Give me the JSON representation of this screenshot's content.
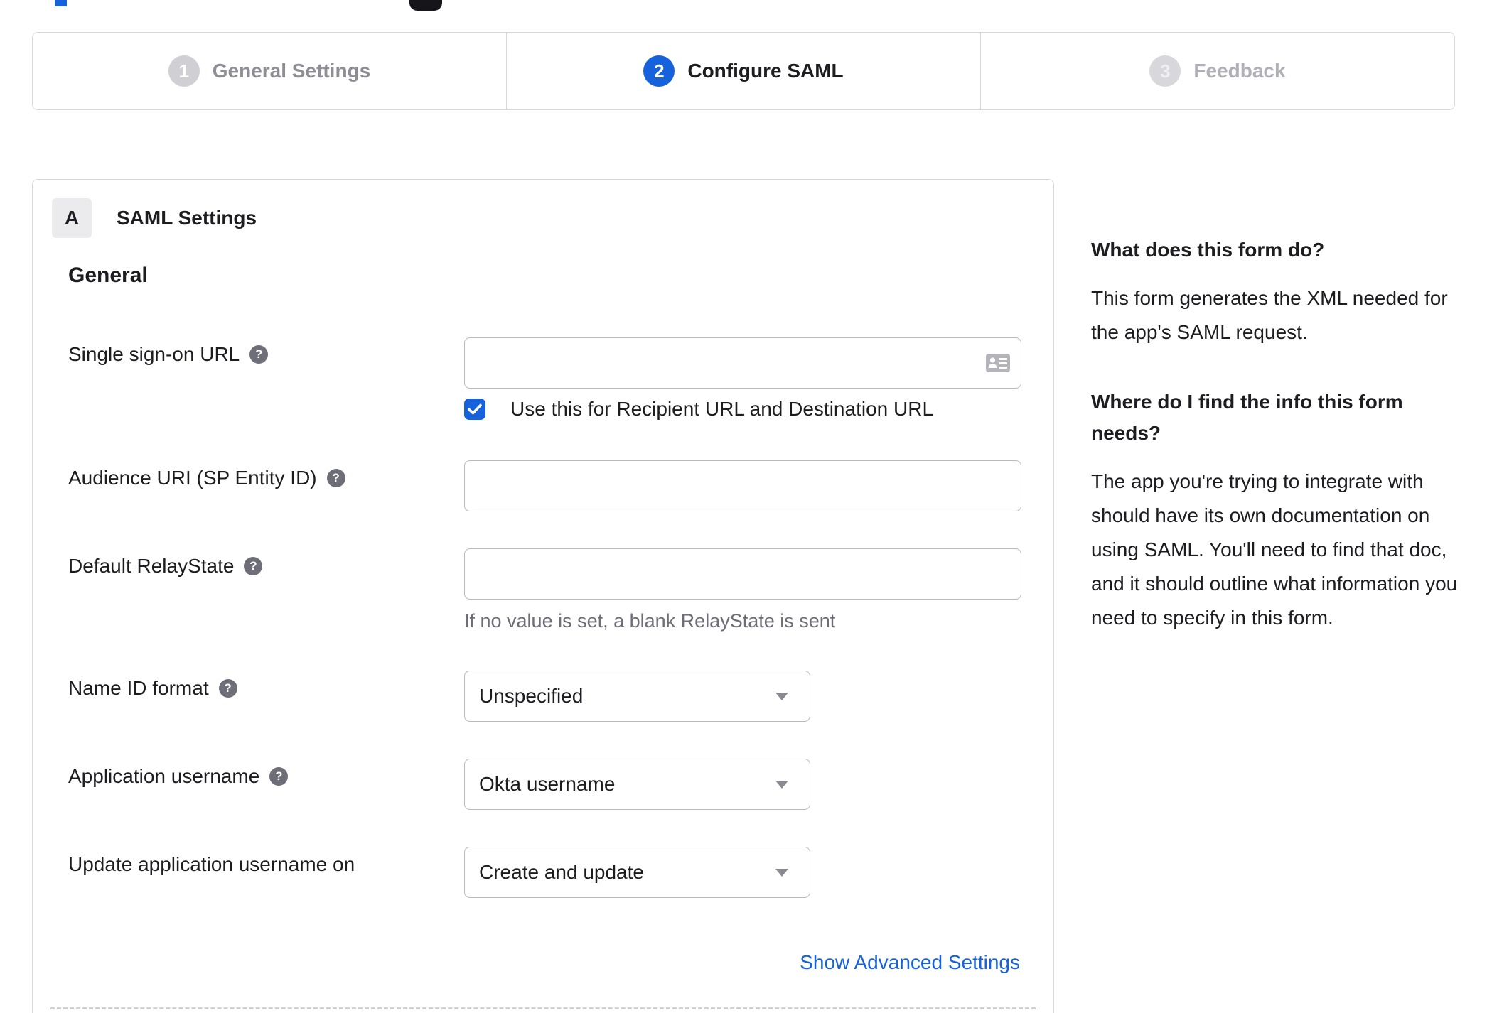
{
  "colors": {
    "accent_blue": "#1662dd",
    "text": "#1d1d21",
    "muted_gray": "#6e6e78",
    "border_gray": "#d7d7dc"
  },
  "stepper": {
    "steps": [
      {
        "number": "1",
        "label": "General Settings",
        "state": "complete"
      },
      {
        "number": "2",
        "label": "Configure SAML",
        "state": "active"
      },
      {
        "number": "3",
        "label": "Feedback",
        "state": "upcoming"
      }
    ]
  },
  "form": {
    "section_badge": "A",
    "section_title": "SAML Settings",
    "group_heading": "General",
    "fields": {
      "sso_url": {
        "label": "Single sign-on URL",
        "value": "",
        "checkbox_label": "Use this for Recipient URL and Destination URL",
        "checkbox_checked": true
      },
      "audience_uri": {
        "label": "Audience URI (SP Entity ID)",
        "value": ""
      },
      "default_relay_state": {
        "label": "Default RelayState",
        "value": "",
        "helper": "If no value is set, a blank RelayState is sent"
      },
      "name_id_format": {
        "label": "Name ID format",
        "value": "Unspecified"
      },
      "application_username": {
        "label": "Application username",
        "value": "Okta username"
      },
      "update_app_username_on": {
        "label": "Update application username on",
        "value": "Create and update"
      }
    },
    "advanced_link": "Show Advanced Settings"
  },
  "help_panel": {
    "sections": [
      {
        "heading": "What does this form do?",
        "body": "This form generates the XML needed for the app's SAML request."
      },
      {
        "heading": "Where do I find the info this form needs?",
        "body": "The app you're trying to integrate with should have its own documentation on using SAML. You'll need to find that doc, and it should outline what information you need to specify in this form."
      }
    ]
  }
}
